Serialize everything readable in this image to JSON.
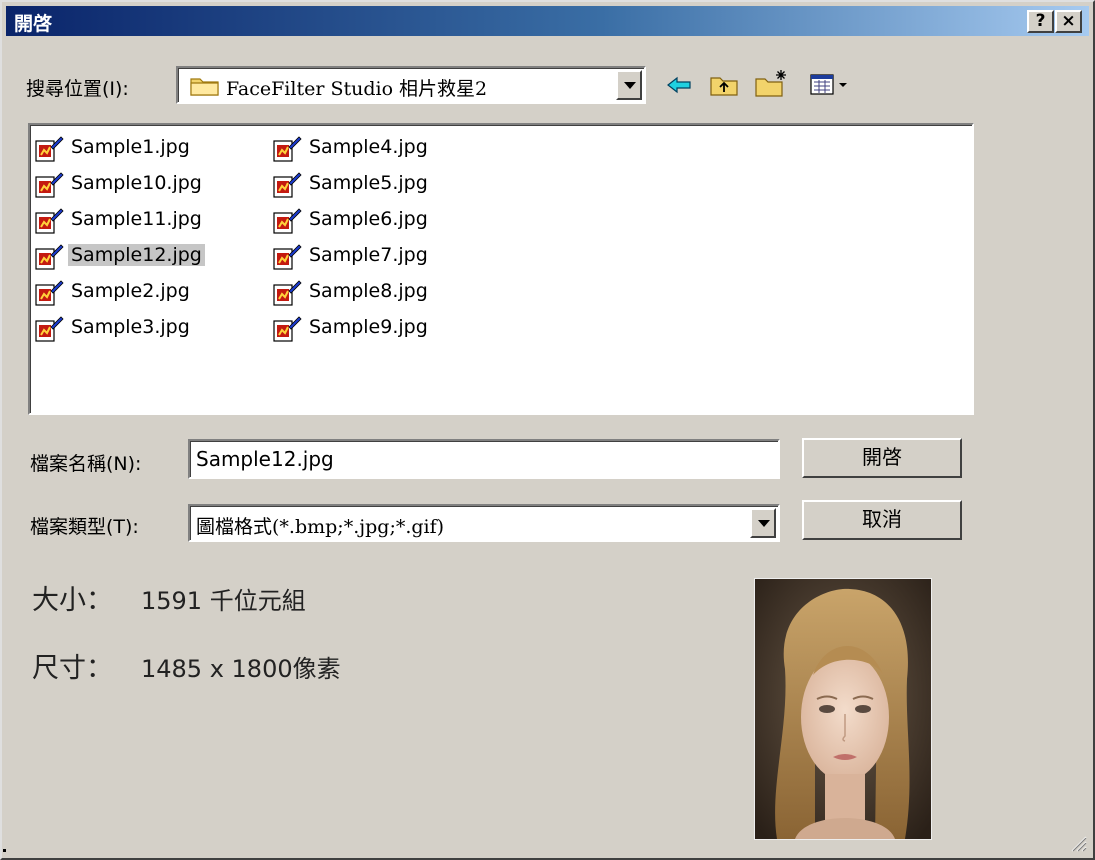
{
  "window": {
    "title": "開啓"
  },
  "titlebar": {
    "help_label": "?",
    "close_label": "×"
  },
  "lookin": {
    "label": "搜尋位置(I):",
    "value": "FaceFilter Studio 相片救星2"
  },
  "files": [
    [
      "Sample1.jpg",
      "Sample10.jpg",
      "Sample11.jpg",
      "Sample12.jpg",
      "Sample2.jpg",
      "Sample3.jpg"
    ],
    [
      "Sample4.jpg",
      "Sample5.jpg",
      "Sample6.jpg",
      "Sample7.jpg",
      "Sample8.jpg",
      "Sample9.jpg"
    ]
  ],
  "selected_file": "Sample12.jpg",
  "filename": {
    "label": "檔案名稱(N):",
    "value": "Sample12.jpg"
  },
  "filetype": {
    "label": "檔案類型(T):",
    "value": "圖檔格式(*.bmp;*.jpg;*.gif)"
  },
  "buttons": {
    "open": "開啓",
    "cancel": "取消"
  },
  "info": {
    "size_label": "大小：",
    "size_value": "1591 千位元組",
    "dim_label": "尺寸：",
    "dim_value": "1485 x 1800像素"
  },
  "colors": {
    "title_start": "#0a246a",
    "title_end": "#a6caf0",
    "face": "#d4d0c8"
  },
  "icons": {
    "lookin": "folder-icon",
    "back": "back-arrow-icon",
    "up": "up-folder-icon",
    "new": "new-folder-icon",
    "view": "view-menu-icon",
    "file": "image-file-icon"
  }
}
